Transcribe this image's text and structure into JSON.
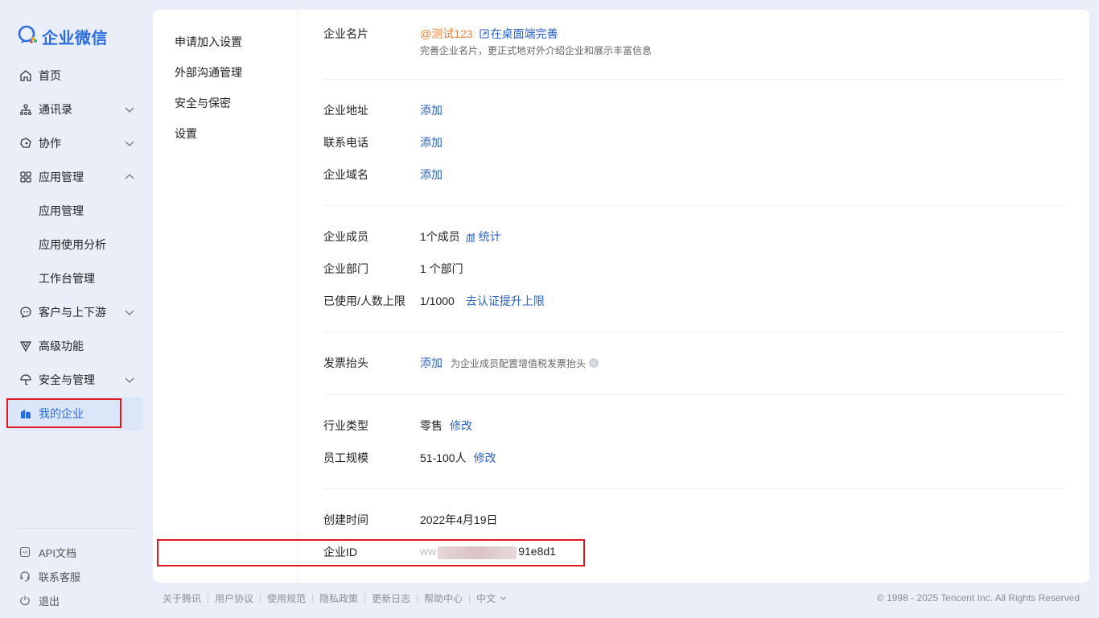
{
  "app": {
    "logo_text": "企业微信",
    "brand_color": "#2b6de0"
  },
  "sidebar": {
    "items": [
      {
        "label": "首页",
        "icon": "home-icon"
      },
      {
        "label": "通讯录",
        "icon": "org-chart-icon",
        "chevron": "down"
      },
      {
        "label": "协作",
        "icon": "collaboration-icon",
        "chevron": "down"
      },
      {
        "label": "应用管理",
        "icon": "apps-grid-icon",
        "chevron": "up"
      },
      {
        "label": "应用管理",
        "sub": true
      },
      {
        "label": "应用使用分析",
        "sub": true
      },
      {
        "label": "工作台管理",
        "sub": true
      },
      {
        "label": "客户与上下游",
        "icon": "chat-bubble-icon",
        "chevron": "down"
      },
      {
        "label": "高级功能",
        "icon": "advanced-icon"
      },
      {
        "label": "安全与管理",
        "icon": "umbrella-icon",
        "chevron": "down"
      },
      {
        "label": "我的企业",
        "icon": "company-icon",
        "active": true
      }
    ],
    "bottom": [
      {
        "label": "API文档",
        "icon": "api-doc-icon"
      },
      {
        "label": "联系客服",
        "icon": "headset-icon"
      },
      {
        "label": "退出",
        "icon": "power-icon"
      }
    ]
  },
  "subnav": [
    "申请加入设置",
    "外部沟通管理",
    "安全与保密",
    "设置"
  ],
  "company": {
    "card_label": "企业名片",
    "card_name": "@测试123",
    "card_action": "在桌面端完善",
    "card_hint": "完善企业名片，更正式地对外介绍企业和展示丰富信息",
    "address_label": "企业地址",
    "address_action": "添加",
    "phone_label": "联系电话",
    "phone_action": "添加",
    "domain_label": "企业域名",
    "domain_action": "添加",
    "members_label": "企业成员",
    "members_value": "1个成员",
    "members_action": "统计",
    "depts_label": "企业部门",
    "depts_value": "1 个部门",
    "limit_label": "已使用/人数上限",
    "limit_value": "1/1000",
    "limit_action": "去认证提升上限",
    "invoice_label": "发票抬头",
    "invoice_action": "添加",
    "invoice_hint": "为企业成员配置增值税发票抬头",
    "industry_label": "行业类型",
    "industry_value": "零售",
    "industry_action": "修改",
    "size_label": "员工规模",
    "size_value": "51-100人",
    "size_action": "修改",
    "created_label": "创建时间",
    "created_value": "2022年4月19日",
    "id_label": "企业ID",
    "id_prefix": "ww",
    "id_suffix": "91e8d1"
  },
  "footer": {
    "links": [
      "关于腾讯",
      "用户协议",
      "使用规范",
      "隐私政策",
      "更新日志",
      "帮助中心",
      "中文"
    ],
    "copyright": "© 1998 - 2025 Tencent Inc. All Rights Reserved"
  },
  "colors": {
    "link": "#2a61c4",
    "accent_orange": "#f0813a",
    "highlight_red": "#e0191e"
  }
}
